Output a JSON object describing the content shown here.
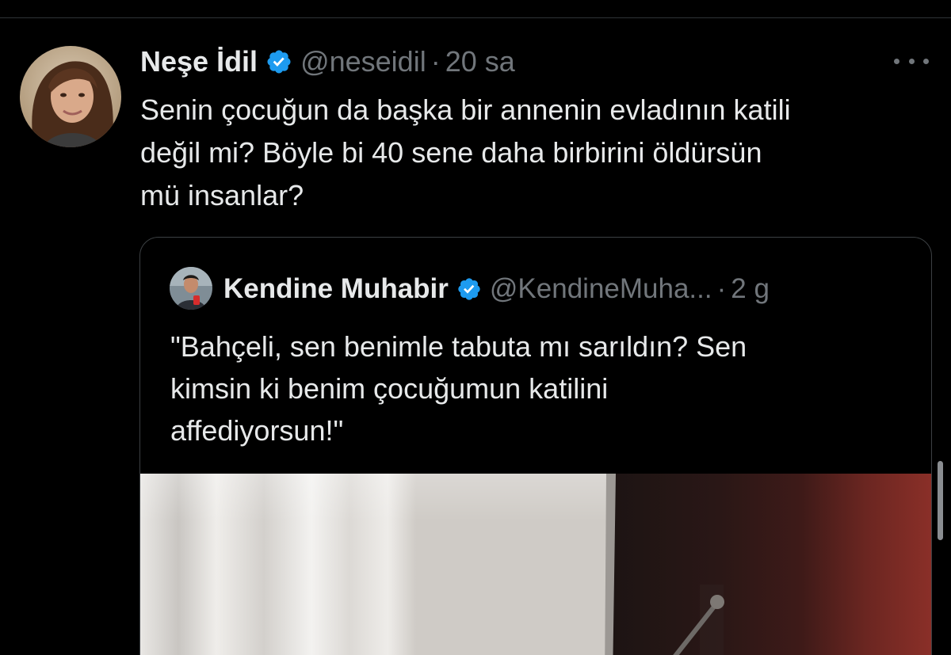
{
  "tweet": {
    "author_name": "Neşe İdil",
    "handle": "@neseidil",
    "separator": "·",
    "time": "20 sa",
    "avatar_icon": "user-avatar",
    "verified_icon": "verified-badge-icon",
    "text_lines": [
      "Senin çocuğun da başka bir annenin evladının katili",
      "değil mi? Böyle bi 40 sene daha birbirini öldürsün",
      "mü insanlar?"
    ]
  },
  "quoted_tweet": {
    "author_name": "Kendine Muhabir",
    "handle": "@KendineMuha...",
    "separator": "·",
    "time": "2 g",
    "text_lines": [
      "\"Bahçeli, sen benimle tabuta mı sarıldın? Sen",
      "kimsin ki benim çocuğumun katilini",
      "affediyorsun!\""
    ]
  },
  "colors": {
    "background": "#000000",
    "text_primary": "#e7e9ea",
    "text_secondary": "#71767b",
    "verified": "#1d9bf0",
    "border": "#3c4043"
  }
}
